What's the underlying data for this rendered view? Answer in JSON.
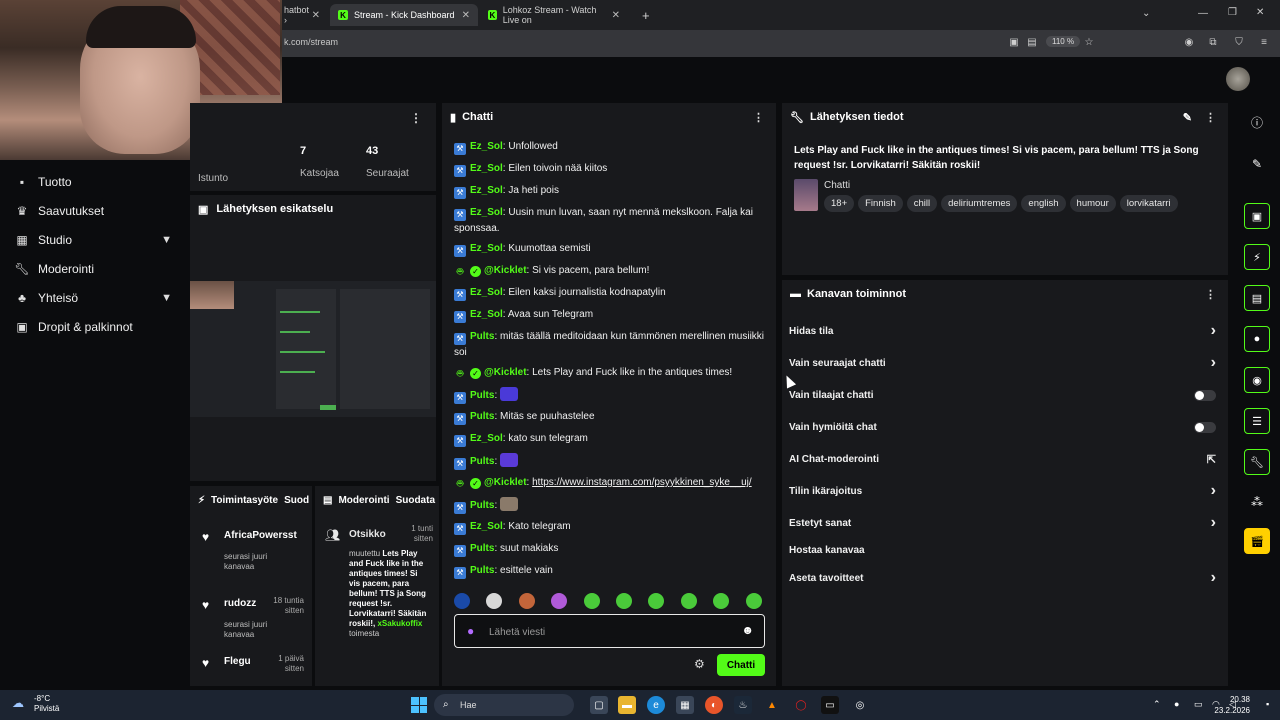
{
  "browser": {
    "tabs": [
      {
        "label": "hatbot ›",
        "active": false
      },
      {
        "label": "Stream - Kick Dashboard",
        "active": true
      },
      {
        "label": "Lohkoz Stream - Watch Live on",
        "active": false
      }
    ],
    "url": "k.com/stream",
    "zoom": "110 %"
  },
  "nav": {
    "items": [
      {
        "label": "Tuotto",
        "icon": "dollar-icon"
      },
      {
        "label": "Saavutukset",
        "icon": "trophy-icon"
      },
      {
        "label": "Studio",
        "icon": "studio-icon",
        "expandable": true
      },
      {
        "label": "Moderointi",
        "icon": "wrench-icon"
      },
      {
        "label": "Yhteisö",
        "icon": "community-icon",
        "expandable": true
      },
      {
        "label": "Dropit & palkinnot",
        "icon": "gift-icon"
      }
    ]
  },
  "stats": {
    "session_label": "Istunto",
    "viewers_value": "7",
    "viewers_label": "Katsojaa",
    "followers_value": "43",
    "followers_label": "Seuraajat"
  },
  "preview": {
    "title": "Lähetyksen esikatselu"
  },
  "activity": {
    "title": "Toimintasyöte",
    "title_overflow": "Suod",
    "items": [
      {
        "name": "AfricaPowersst",
        "sub": "seurasi juuri kanavaa",
        "time": ""
      },
      {
        "name": "rudozz",
        "sub": "seurasi juuri kanavaa",
        "time": "18 tuntia sitten"
      },
      {
        "name": "Flegu",
        "sub": "",
        "time": "1 päivä sitten"
      }
    ]
  },
  "moderation": {
    "title": "Moderointi",
    "title_overflow": "Suodata",
    "item_title": "Otsikko",
    "item_time": "1 tunti sitten",
    "item_text_prefix": "muutettu",
    "item_text_bold": "Lets Play and Fuck like in the antiques times! Si vis pacem, para bellum! TTS ja Song request !sr. Lorvikatarri! Säkitän roskii!,",
    "item_actor": "xSakukoffix",
    "item_suffix": "toimesta"
  },
  "chat": {
    "title": "Chatti",
    "messages": [
      {
        "user": "Ez_Sol",
        "color": "#53fc18",
        "badge": "wrench",
        "text": "Unfollowed"
      },
      {
        "user": "Ez_Sol",
        "color": "#53fc18",
        "badge": "wrench",
        "text": "Eilen toivoin nää kiitos"
      },
      {
        "user": "Ez_Sol",
        "color": "#53fc18",
        "badge": "wrench",
        "text": "Ja heti pois"
      },
      {
        "user": "Ez_Sol",
        "color": "#53fc18",
        "badge": "wrench",
        "text": "Uusin mun luvan, saan nyt mennä mekslkoon. Falja kai sponssaa."
      },
      {
        "user": "Ez_Sol",
        "color": "#53fc18",
        "badge": "wrench",
        "text": "Kuumottaa semisti"
      },
      {
        "user": "@Kicklet",
        "color": "#53fc18",
        "badge": "bot",
        "text": "Si vis pacem, para bellum!"
      },
      {
        "user": "Ez_Sol",
        "color": "#53fc18",
        "badge": "wrench",
        "text": "Eilen kaksi journalistia kodnapatylin"
      },
      {
        "user": "Ez_Sol",
        "color": "#53fc18",
        "badge": "wrench",
        "text": "Avaa sun Telegram"
      },
      {
        "user": "Pults",
        "color": "#53fc18",
        "badge": "wrench",
        "text": "mitäs täällä meditoidaan kun tämmönen merellinen musiikki soi"
      },
      {
        "user": "@Kicklet",
        "color": "#53fc18",
        "badge": "bot",
        "text": "Lets Play and Fuck like in the antiques times!"
      },
      {
        "user": "Pults",
        "color": "#53fc18",
        "badge": "wrench",
        "text": "",
        "emote": "#4a3ad8"
      },
      {
        "user": "Pults",
        "color": "#53fc18",
        "badge": "wrench",
        "text": "Mitäs se puuhastelee"
      },
      {
        "user": "Ez_Sol",
        "color": "#53fc18",
        "badge": "wrench",
        "text": "kato sun telegram"
      },
      {
        "user": "Pults",
        "color": "#53fc18",
        "badge": "wrench",
        "text": "",
        "emote": "#5a3ad8"
      },
      {
        "user": "@Kicklet",
        "color": "#53fc18",
        "badge": "bot",
        "text": "https://www.instagram.com/psyykkinen_syke__uj/",
        "link": true
      },
      {
        "user": "Pults",
        "color": "#53fc18",
        "badge": "wrench",
        "text": "",
        "emote": "#8a7a6a"
      },
      {
        "user": "Ez_Sol",
        "color": "#53fc18",
        "badge": "wrench",
        "text": "Kato telegram"
      },
      {
        "user": "Pults",
        "color": "#53fc18",
        "badge": "wrench",
        "text": "suut makiaks"
      },
      {
        "user": "Pults",
        "color": "#53fc18",
        "badge": "wrench",
        "text": "esittele vain"
      }
    ],
    "emote_colors": [
      "#1a4aa8",
      "#d8d8d8",
      "#c2653a",
      "#b05ad8",
      "#4acb3a",
      "#4acb3a",
      "#4acb3a",
      "#4acb3a",
      "#4acb3a",
      "#4acb3a"
    ],
    "input_placeholder": "Lähetä viesti",
    "send_label": "Chatti"
  },
  "stream_info": {
    "title": "Lähetyksen tiedot",
    "stream_title": "Lets Play and Fuck like in the antiques times! Si vis pacem, para bellum! TTS ja Song request !sr. Lorvikatarri! Säkitän roskii!",
    "category": "Chatti",
    "tags": [
      "18+",
      "Finnish",
      "chill",
      "deliriumtremes",
      "english",
      "humour",
      "lorvikatarri"
    ]
  },
  "channel_actions": {
    "title": "Kanavan toiminnot",
    "rows": [
      {
        "label": "Hidas tila",
        "control": "chevron"
      },
      {
        "label": "Vain seuraajat chatti",
        "control": "chevron"
      },
      {
        "label": "Vain tilaajat chatti",
        "control": "toggle"
      },
      {
        "label": "Vain hymiöitä chat",
        "control": "toggle"
      },
      {
        "label": "AI Chat-moderointi",
        "control": "external"
      },
      {
        "label": "Tilin ikärajoitus",
        "control": "chevron"
      },
      {
        "label": "Estetyt sanat",
        "control": "chevron"
      },
      {
        "label": "Hostaa kanavaa",
        "control": "none"
      },
      {
        "label": "Aseta tavoitteet",
        "control": "chevron"
      }
    ]
  },
  "taskbar": {
    "weather_temp": "-8°C",
    "weather_cond": "Pilvistä",
    "search_placeholder": "Hae",
    "time": "20.38",
    "date": "23.2.2026"
  },
  "colors": {
    "accent": "#53fc18",
    "panel": "#18191c",
    "bg": "#0b0c0e"
  }
}
